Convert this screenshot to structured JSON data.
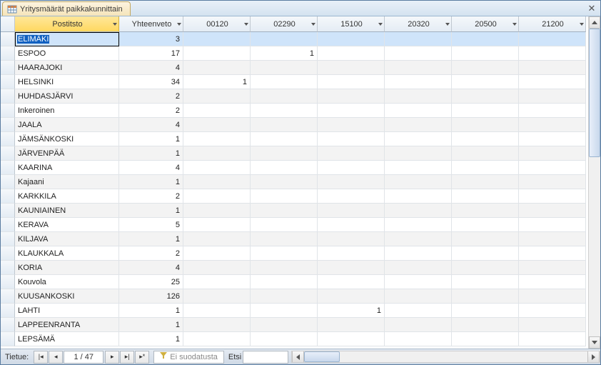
{
  "tab": {
    "title": "Yritysmäärät paikkakunnittain"
  },
  "columns": {
    "first": "Postitsto",
    "summary": "Yhteenveto",
    "codes": [
      "00120",
      "02290",
      "15100",
      "20320",
      "20500",
      "21200"
    ]
  },
  "rows": [
    {
      "name": "ELIMÄKI",
      "summary": 3,
      "v": [
        null,
        null,
        null,
        null,
        null,
        null
      ],
      "selected": true,
      "editing": true
    },
    {
      "name": "ESPOO",
      "summary": 17,
      "v": [
        null,
        1,
        null,
        null,
        null,
        null
      ]
    },
    {
      "name": "HAARAJOKI",
      "summary": 4,
      "v": [
        null,
        null,
        null,
        null,
        null,
        null
      ]
    },
    {
      "name": "HELSINKI",
      "summary": 34,
      "v": [
        1,
        null,
        null,
        null,
        null,
        null
      ]
    },
    {
      "name": "HUHDASJÄRVI",
      "summary": 2,
      "v": [
        null,
        null,
        null,
        null,
        null,
        null
      ]
    },
    {
      "name": "Inkeroinen",
      "summary": 2,
      "v": [
        null,
        null,
        null,
        null,
        null,
        null
      ]
    },
    {
      "name": "JAALA",
      "summary": 4,
      "v": [
        null,
        null,
        null,
        null,
        null,
        null
      ]
    },
    {
      "name": "JÄMSÄNKOSKI",
      "summary": 1,
      "v": [
        null,
        null,
        null,
        null,
        null,
        null
      ]
    },
    {
      "name": "JÄRVENPÄÄ",
      "summary": 1,
      "v": [
        null,
        null,
        null,
        null,
        null,
        null
      ]
    },
    {
      "name": "KAARINA",
      "summary": 4,
      "v": [
        null,
        null,
        null,
        null,
        null,
        null
      ]
    },
    {
      "name": "Kajaani",
      "summary": 1,
      "v": [
        null,
        null,
        null,
        null,
        null,
        null
      ]
    },
    {
      "name": "KARKKILA",
      "summary": 2,
      "v": [
        null,
        null,
        null,
        null,
        null,
        null
      ]
    },
    {
      "name": "KAUNIAINEN",
      "summary": 1,
      "v": [
        null,
        null,
        null,
        null,
        null,
        null
      ]
    },
    {
      "name": "KERAVA",
      "summary": 5,
      "v": [
        null,
        null,
        null,
        null,
        null,
        null
      ]
    },
    {
      "name": "KILJAVA",
      "summary": 1,
      "v": [
        null,
        null,
        null,
        null,
        null,
        null
      ]
    },
    {
      "name": "KLAUKKALA",
      "summary": 2,
      "v": [
        null,
        null,
        null,
        null,
        null,
        null
      ]
    },
    {
      "name": "KORIA",
      "summary": 4,
      "v": [
        null,
        null,
        null,
        null,
        null,
        null
      ]
    },
    {
      "name": "Kouvola",
      "summary": 25,
      "v": [
        null,
        null,
        null,
        null,
        null,
        null
      ]
    },
    {
      "name": "KUUSANKOSKI",
      "summary": 126,
      "v": [
        null,
        null,
        null,
        null,
        null,
        null
      ]
    },
    {
      "name": "LAHTI",
      "summary": 1,
      "v": [
        null,
        null,
        1,
        null,
        null,
        null
      ]
    },
    {
      "name": "LAPPEENRANTA",
      "summary": 1,
      "v": [
        null,
        null,
        null,
        null,
        null,
        null
      ]
    },
    {
      "name": "LEPSÄMÄ",
      "summary": 1,
      "v": [
        null,
        null,
        null,
        null,
        null,
        null
      ]
    }
  ],
  "nav": {
    "label": "Tietue:",
    "record": "1 / 47",
    "filter": "Ei suodatusta",
    "search": "Etsi"
  }
}
